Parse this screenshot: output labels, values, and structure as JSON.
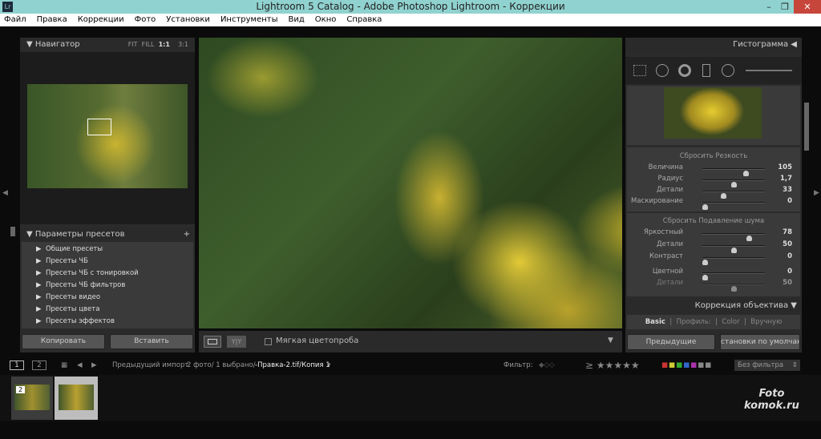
{
  "window": {
    "title": "Lightroom 5 Catalog - Adobe Photoshop Lightroom - Коррекции",
    "app_icon": "Lr"
  },
  "menu": [
    "Файл",
    "Правка",
    "Коррекции",
    "Фото",
    "Установки",
    "Инструменты",
    "Вид",
    "Окно",
    "Справка"
  ],
  "navigator": {
    "title": "Навигатор",
    "zoom": [
      "FIT",
      "FILL",
      "1:1",
      "3:1"
    ]
  },
  "presets": {
    "title": "Параметры пресетов",
    "items": [
      "Общие пресеты",
      "Пресеты ЧБ",
      "Пресеты ЧБ с тонировкой",
      "Пресеты ЧБ фильтров",
      "Пресеты видео",
      "Пресеты цвета",
      "Пресеты эффектов"
    ]
  },
  "left_buttons": {
    "copy": "Копировать",
    "paste": "Вставить"
  },
  "toolbar": {
    "softproof": "Мягкая цветопроба"
  },
  "right": {
    "histogram": "Гистограмма",
    "sharpen": {
      "reset": "Сбросить Резкость",
      "sliders": [
        {
          "label": "Величина",
          "value": "105",
          "pos": 0.72
        },
        {
          "label": "Радиус",
          "value": "1,7",
          "pos": 0.5
        },
        {
          "label": "Детали",
          "value": "33",
          "pos": 0.33
        },
        {
          "label": "Маскирование",
          "value": "0",
          "pos": 0
        }
      ]
    },
    "noise": {
      "reset": "Сбросить Подавление шума",
      "sliders": [
        {
          "label": "Яркостный",
          "value": "78",
          "pos": 0.78
        },
        {
          "label": "Детали",
          "value": "50",
          "pos": 0.5
        },
        {
          "label": "Контраст",
          "value": "0",
          "pos": 0
        }
      ],
      "color": [
        {
          "label": "Цветной",
          "value": "0",
          "pos": 0
        },
        {
          "label": "Детали",
          "value": "50",
          "pos": 0.5
        }
      ]
    },
    "lens": {
      "title": "Коррекция объектива",
      "tabs": [
        "Basic",
        "Профиль:",
        "Color",
        "Вручную"
      ]
    },
    "prev_button": "Предыдущие",
    "defaults_button": "становки по умолчанию."
  },
  "filmstrip": {
    "pages": [
      "1",
      "2"
    ],
    "source": "Предыдущий импорт",
    "info": "2 фото/  1 выбрано/",
    "file": "-Правка-2.tif/Копия 1",
    "filter_label": "Фильтр:",
    "rating": "≥ ★★★★★",
    "filter_preset": "Без фильтра",
    "thumb_badge": "2"
  },
  "watermark": "Foto komok.ru"
}
